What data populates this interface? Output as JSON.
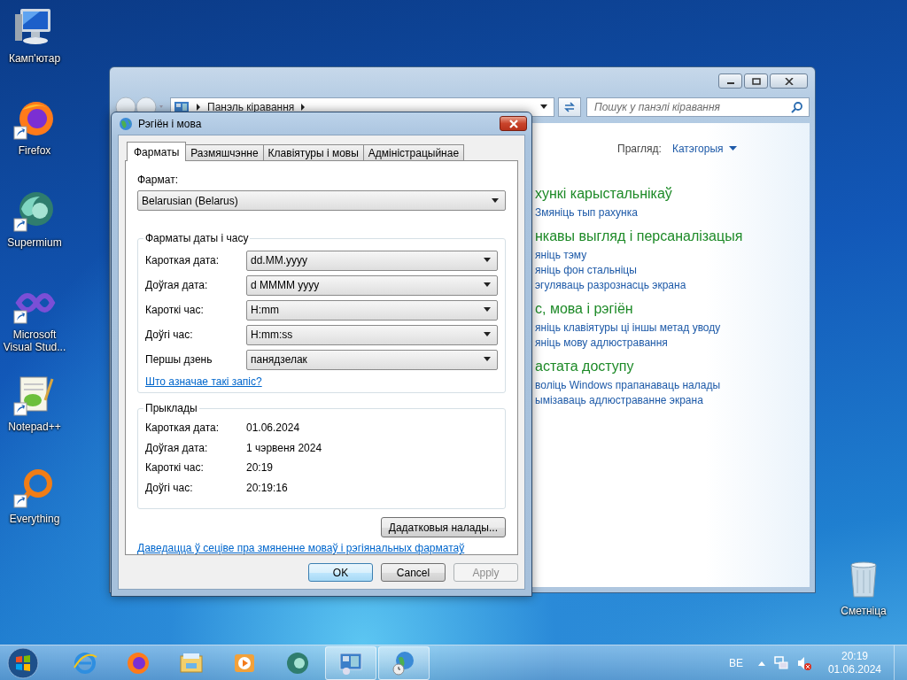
{
  "desktop_icons": [
    {
      "label": "Камп'ютар",
      "kind": "computer",
      "shortcut": false
    },
    {
      "label": "Firefox",
      "kind": "firefox",
      "shortcut": true
    },
    {
      "label": "Supermium",
      "kind": "supermium",
      "shortcut": true
    },
    {
      "label": "Microsoft Visual Stud...",
      "kind": "visual-studio",
      "shortcut": true
    },
    {
      "label": "Notepad++",
      "kind": "notepad",
      "shortcut": true
    },
    {
      "label": "Everything",
      "kind": "everything",
      "shortcut": true
    }
  ],
  "recycle_bin": {
    "label": "Сметніца"
  },
  "control_panel": {
    "address": "Панэль кіравання",
    "search_placeholder": "Пошук у панэлі кіравання",
    "view_label": "Прагляд:",
    "view_value": "Катэгорыя",
    "categories": [
      {
        "title": "хункі карыстальнікаў",
        "links": [
          "Змяніць тып рахунка"
        ]
      },
      {
        "title": "нкавы выгляд і персаналізацыя",
        "links": [
          "яніць тэму",
          "яніць фон стальніцы",
          "эгуляваць разрознасць экрана"
        ]
      },
      {
        "title": "с, мова і рэгіён",
        "links": [
          "яніць клавіятуры ці іншы метад уводу",
          "яніць мову адлюстравання"
        ]
      },
      {
        "title": "астата доступу",
        "links": [
          "воліць Windows прапанаваць налады",
          "ымізаваць адлюстраванне экрана"
        ]
      }
    ]
  },
  "dialog": {
    "title": "Рэгіён і мова",
    "tabs": [
      {
        "label": "Фарматы",
        "selected": true
      },
      {
        "label": "Размяшчэнне",
        "selected": false
      },
      {
        "label": "Клавіятуры і мовы",
        "selected": false
      },
      {
        "label": "Адміністрацыйнае",
        "selected": false
      }
    ],
    "format_label": "Фармат:",
    "format_value": "Belarusian (Belarus)",
    "date_time_group": {
      "title": "Фарматы даты і часу",
      "rows": [
        {
          "label": "Кароткая дата:",
          "value": "dd.MM.yyyy"
        },
        {
          "label": "Доўгая дата:",
          "value": "d MMMM yyyy"
        },
        {
          "label": "Кароткі час:",
          "value": "H:mm"
        },
        {
          "label": "Доўгі час:",
          "value": "H:mm:ss"
        },
        {
          "label": "Першы дзень",
          "value": "панядзелак"
        }
      ],
      "link": "Што азначае такі запіс?"
    },
    "examples": {
      "title": "Прыклады",
      "rows": [
        {
          "label": "Кароткая дата:",
          "value": "01.06.2024"
        },
        {
          "label": "Доўгая дата:",
          "value": "1 чэрвеня 2024"
        },
        {
          "label": "Кароткі час:",
          "value": "20:19"
        },
        {
          "label": "Доўгі час:",
          "value": "20:19:16"
        }
      ]
    },
    "additional_button": "Дадатковыя налады...",
    "online_link": "Даведацца ў сеціве пра змяненне моваў і рэгіянальных фарматаў",
    "buttons": [
      {
        "label": "OK",
        "kind": "default",
        "disabled": false
      },
      {
        "label": "Cancel",
        "kind": "normal",
        "disabled": false
      },
      {
        "label": "Apply",
        "kind": "normal",
        "disabled": true
      }
    ]
  },
  "taskbar": {
    "apps": [
      {
        "kind": "ie",
        "active": false
      },
      {
        "kind": "firefox",
        "active": false
      },
      {
        "kind": "explorer",
        "active": false
      },
      {
        "kind": "media",
        "active": false
      },
      {
        "kind": "supermium",
        "active": false
      },
      {
        "kind": "control-panel",
        "active": true
      },
      {
        "kind": "region",
        "active": true
      }
    ],
    "language": "BE",
    "time": "20:19",
    "date": "01.06.2024"
  }
}
